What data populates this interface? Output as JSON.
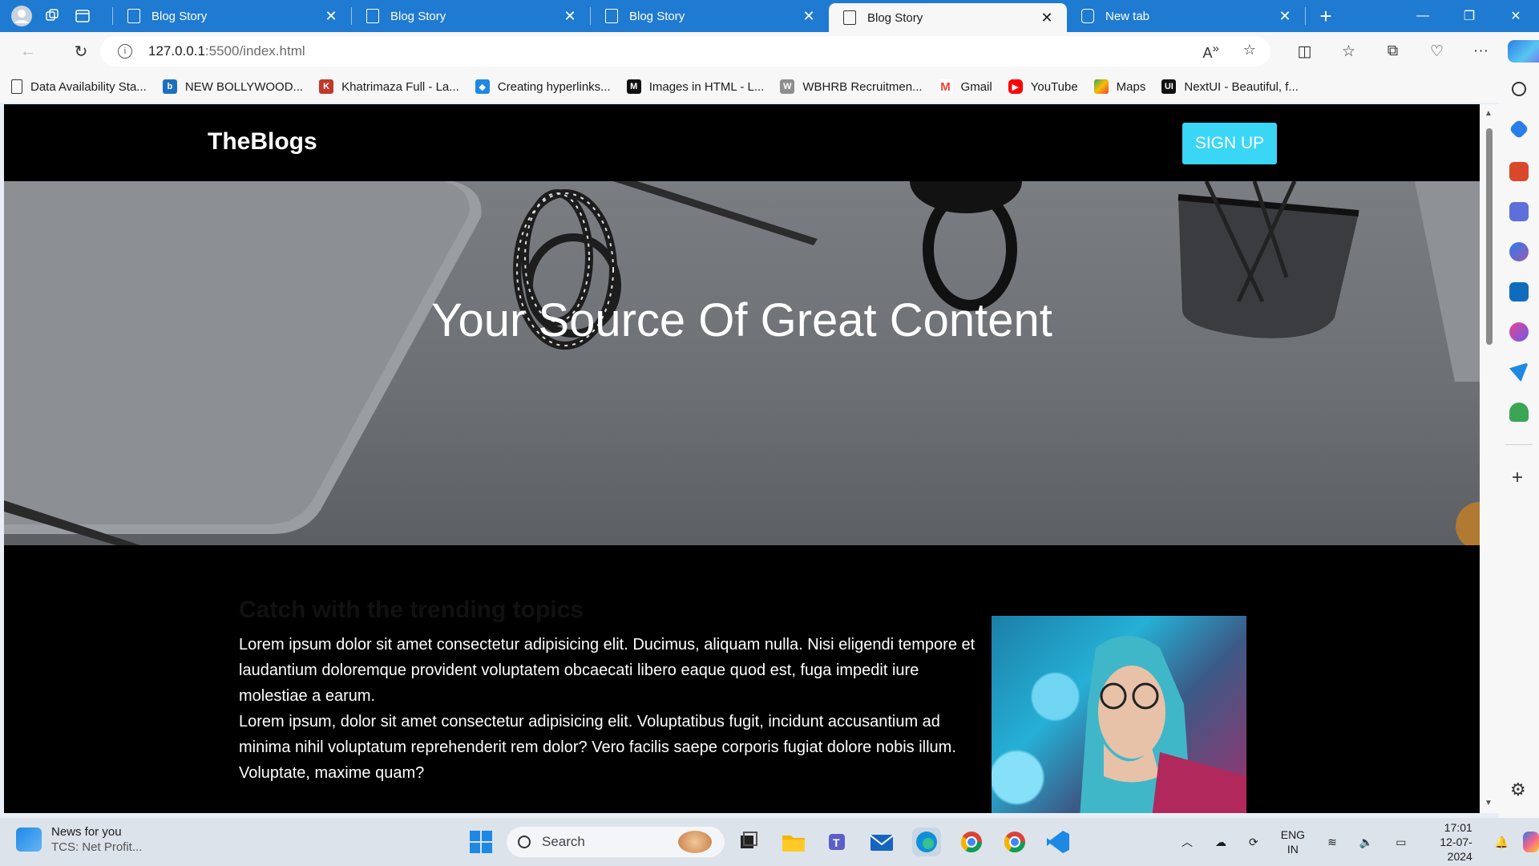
{
  "browser": {
    "tabs": [
      {
        "label": "Blog Story",
        "active": false
      },
      {
        "label": "Blog Story",
        "active": false
      },
      {
        "label": "Blog Story",
        "active": false
      },
      {
        "label": "Blog Story",
        "active": true
      },
      {
        "label": "New tab",
        "active": false
      }
    ],
    "address": {
      "host": "127.0.0.1",
      "path": ":5500/index.html"
    },
    "bookmarks": [
      {
        "label": "Data Availability Sta...",
        "color": "#ffffff"
      },
      {
        "label": "NEW BOLLYWOOD...",
        "color": "#1e6fbf"
      },
      {
        "label": "Khatrimaza Full - La...",
        "color": "#c0392b"
      },
      {
        "label": "Creating hyperlinks...",
        "color": "#1e88e5"
      },
      {
        "label": "Images in HTML - L...",
        "color": "#111111"
      },
      {
        "label": "WBHRB Recruitmen...",
        "color": "#8e8e8e"
      },
      {
        "label": "Gmail",
        "color": "#ea4335"
      },
      {
        "label": "YouTube",
        "color": "#ff0000"
      },
      {
        "label": "Maps",
        "color": "#34a853"
      },
      {
        "label": "NextUI - Beautiful, f...",
        "color": "#111111"
      }
    ]
  },
  "site": {
    "logo": "TheBlogs",
    "signup_label": "SIGN UP",
    "accent": "#3ad6f5",
    "hero_title": "Your Source Of Great Content",
    "section_title": "Catch with the trending topics",
    "para1": "Lorem ipsum dolor sit amet consectetur adipisicing elit. Ducimus, aliquam nulla. Nisi eligendi tempore et laudantium doloremque provident voluptatem obcaecati libero eaque quod est, fuga impedit iure molestiae a earum.",
    "para2": "Lorem ipsum, dolor sit amet consectetur adipisicing elit. Voluptatibus fugit, incidunt accusantium ad minima nihil voluptatum reprehenderit rem dolor? Vero facilis saepe corporis fugiat dolore nobis illum. Voluptate, maxime quam?"
  },
  "taskbar": {
    "news_title": "News for you",
    "news_sub": "TCS: Net Profit...",
    "search_label": "Search",
    "lang_line1": "ENG",
    "lang_line2": "IN",
    "time": "17:01",
    "date": "12-07-2024"
  }
}
